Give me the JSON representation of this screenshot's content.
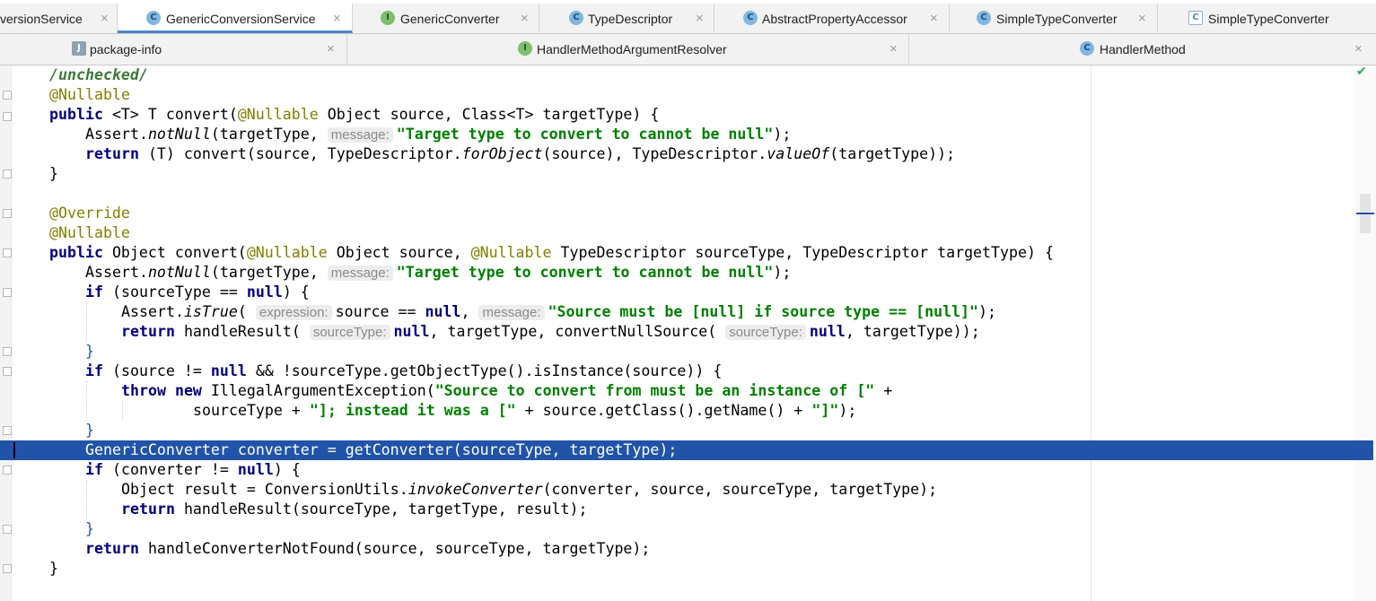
{
  "tabs_row1": [
    {
      "label": "versionService",
      "icon": "class-icon",
      "active": false
    },
    {
      "label": "GenericConversionService",
      "icon": "class-icon",
      "active": true
    },
    {
      "label": "GenericConverter",
      "icon": "interface-icon",
      "active": false
    },
    {
      "label": "TypeDescriptor",
      "icon": "class-icon",
      "active": false
    },
    {
      "label": "AbstractPropertyAccessor",
      "icon": "class-icon",
      "active": false
    },
    {
      "label": "SimpleTypeConverter",
      "icon": "class-icon",
      "active": false
    },
    {
      "label": "SimpleTypeConverter",
      "icon": "generic-class-icon",
      "active": false
    }
  ],
  "tabs_row2": [
    {
      "label": "package-info",
      "icon": "package-icon"
    },
    {
      "label": "HandlerMethodArgumentResolver",
      "icon": "interface-icon"
    },
    {
      "label": "HandlerMethod",
      "icon": "class-icon"
    }
  ],
  "tab_close_glyph": "×",
  "editor": {
    "hints": {
      "message": "message:",
      "expression": "expression:",
      "sourceType": "sourceType:"
    },
    "code": {
      "l1": "/unchecked/",
      "l2": "@Nullable",
      "l3a": "public",
      "l3b": " <T> T convert(",
      "l3c": "@Nullable",
      "l3d": " Object source, Class<T> targetType) {",
      "l4a": "Assert.",
      "l4b": "notNull",
      "l4c": "(targetType, ",
      "l4d": "\"Target type to convert to cannot be null\"",
      "l4e": ");",
      "l5a": "return",
      "l5b": " (T) convert(source, TypeDescriptor.",
      "l5c": "forObject",
      "l5d": "(source), TypeDescriptor.",
      "l5e": "valueOf",
      "l5f": "(targetType));",
      "l6": "}",
      "l8": "@Override",
      "l9": "@Nullable",
      "l10a": "public",
      "l10b": " Object convert(",
      "l10c": "@Nullable",
      "l10d": " Object source, ",
      "l10e": "@Nullable",
      "l10f": " TypeDescriptor sourceType, TypeDescriptor targetType) {",
      "l11a": "Assert.",
      "l11b": "notNull",
      "l11c": "(targetType, ",
      "l11d": "\"Target type to convert to cannot be null\"",
      "l11e": ");",
      "l12a": "if",
      "l12b": " (sourceType == ",
      "l12c": "null",
      "l12d": ") {",
      "l13a": "Assert.",
      "l13b": "isTrue",
      "l13c": "( ",
      "l13d": "source == ",
      "l13e": "null",
      "l13f": ", ",
      "l13g": "\"Source must be [null] if source type == [null]\"",
      "l13h": ");",
      "l14a": "return",
      "l14b": " handleResult( ",
      "l14c": "null",
      "l14d": ", targetType, convertNullSource( ",
      "l14e": "null",
      "l14f": ", targetType));",
      "l15": "}",
      "l16a": "if",
      "l16b": " (source != ",
      "l16c": "null",
      "l16d": " && !sourceType.getObjectType().isInstance(source)) {",
      "l17a": "throw",
      "l17b": " ",
      "l17c": "new",
      "l17d": " IllegalArgumentException(",
      "l17e": "\"Source to convert from must be an instance of [\"",
      "l17f": " +",
      "l18a": "sourceType + ",
      "l18b": "\"]; instead it was a [\"",
      "l18c": " + source.getClass().getName() + ",
      "l18d": "\"]\"",
      "l18e": ");",
      "l19": "}",
      "l20": "GenericConverter converter = getConverter(sourceType, targetType);",
      "l21a": "if",
      "l21b": " (converter != ",
      "l21c": "null",
      "l21d": ") {",
      "l22a": "Object result = ConversionUtils.",
      "l22b": "invokeConverter",
      "l22c": "(converter, source, sourceType, targetType);",
      "l23a": "return",
      "l23b": " handleResult(sourceType, targetType, result);",
      "l24": "}",
      "l25a": "return",
      "l25b": " handleConverterNotFound(source, sourceType, targetType);",
      "l26": "}"
    }
  },
  "status": {
    "check_glyph": "✔"
  },
  "colors": {
    "selection": "#2154a8",
    "keyword": "#000080",
    "string": "#008000",
    "annotation": "#808000",
    "active_tab_underline": "#4a88c7"
  }
}
